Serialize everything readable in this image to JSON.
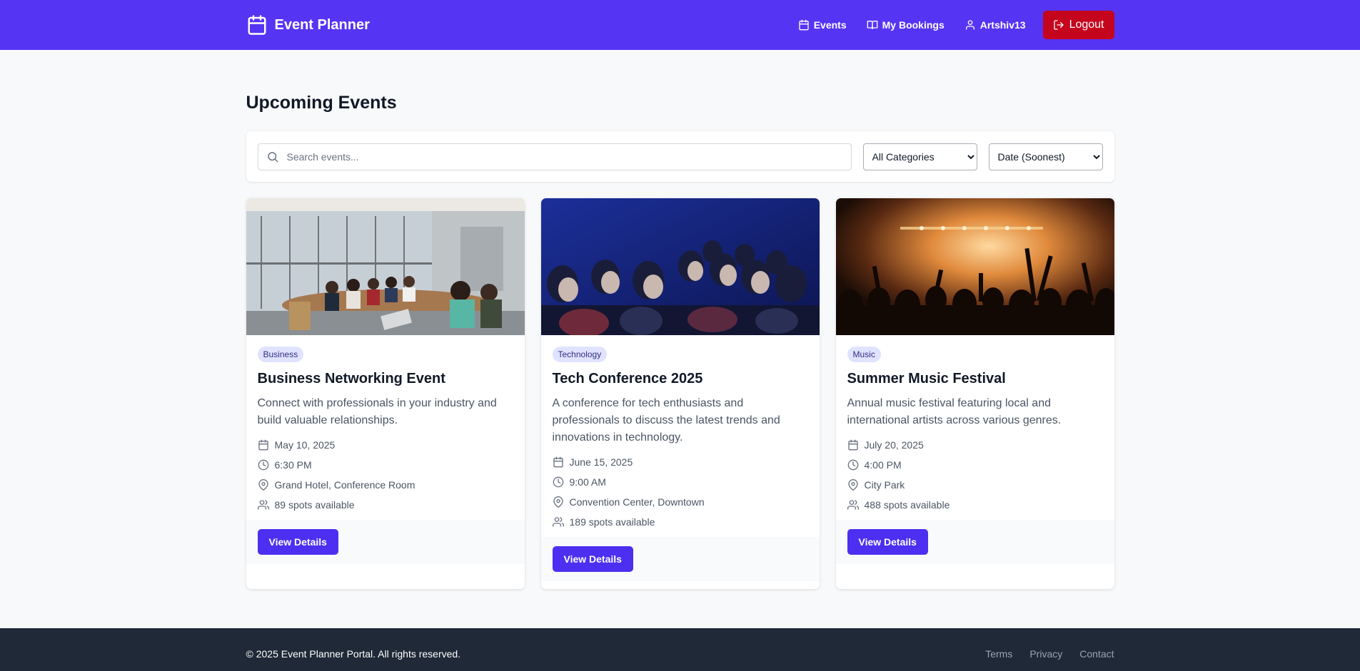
{
  "nav": {
    "brand": "Event Planner",
    "brand_icon": "calendar-icon",
    "links": [
      {
        "label": "Events",
        "icon": "calendar-icon"
      },
      {
        "label": "My Bookings",
        "icon": "book-icon"
      },
      {
        "label": "Artshiv13",
        "icon": "user-icon"
      }
    ],
    "logout_label": "Logout",
    "colors": {
      "bar": "#5634f4",
      "logout": "#c5051d"
    }
  },
  "main": {
    "title": "Upcoming Events",
    "search": {
      "placeholder": "Search events...",
      "value": ""
    },
    "category_select": {
      "selected": "All Categories"
    },
    "sort_select": {
      "selected": "Date (Soonest)"
    }
  },
  "events": [
    {
      "category": "Business",
      "title": "Business Networking Event",
      "description": "Connect with professionals in your industry and build valuable relationships.",
      "date": "May 10, 2025",
      "time": "6:30 PM",
      "location": "Grand Hotel, Conference Room",
      "spots": "89 spots available",
      "button": "View Details"
    },
    {
      "category": "Technology",
      "title": "Tech Conference 2025",
      "description": "A conference for tech enthusiasts and professionals to discuss the latest trends and innovations in technology.",
      "date": "June 15, 2025",
      "time": "9:00 AM",
      "location": "Convention Center, Downtown",
      "spots": "189 spots available",
      "button": "View Details"
    },
    {
      "category": "Music",
      "title": "Summer Music Festival",
      "description": "Annual music festival featuring local and international artists across various genres.",
      "date": "July 20, 2025",
      "time": "4:00 PM",
      "location": "City Park",
      "spots": "488 spots available",
      "button": "View Details"
    }
  ],
  "footer": {
    "copyright": "© 2025 Event Planner Portal. All rights reserved.",
    "links": [
      "Terms",
      "Privacy",
      "Contact"
    ]
  }
}
